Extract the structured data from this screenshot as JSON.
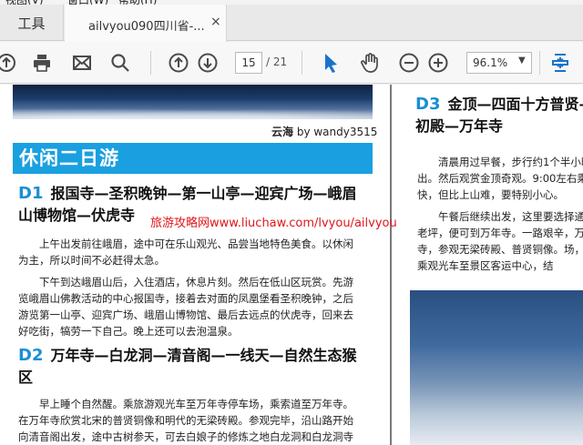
{
  "menu": {
    "items": [
      "视图(V)",
      "窗口(W)",
      "帮助(H)"
    ]
  },
  "tabs": {
    "tools_label": "工具",
    "doc_title": "ailvyou090四川省-...",
    "close_glyph": "×"
  },
  "toolbar": {
    "icons": [
      "upload-icon",
      "print-icon",
      "mail-icon",
      "search-icon",
      "prev-page-icon",
      "next-page-icon",
      "select-cursor-icon",
      "hand-icon",
      "zoom-out-icon",
      "zoom-in-icon",
      "fit-page-icon"
    ],
    "page_current": "15",
    "page_total": "/ 21",
    "zoom_value": "96.1%",
    "zoom_chevron": "▼",
    "accent": "#1a73c9"
  },
  "left_page": {
    "caption_bold": "云海",
    "caption_rest": " by wandy3515",
    "banner": "休闲二日游",
    "banner_color": "#1aa0e0",
    "d1": {
      "num": "D1",
      "title": "报国寺—圣积晚钟—第一山亭—迎宾广场—峨眉山博物馆—伏虎寺",
      "p1": "上午出发前往峨眉，途中可在乐山观光、品尝当地特色美食。以休闲为主，所以时间不必赶得太急。",
      "p2": "下午到达峨眉山后，入住酒店，休息片刻。然后在低山区玩赏。先游览峨眉山佛教活动的中心报国寺，接着去对面的凤凰堡看圣积晚钟，之后游览第一山亭、迎宾广场、峨眉山博物馆、最后去远点的伏虎寺，回来去好吃街，犒劳一下自己。晚上还可以去泡温泉。"
    },
    "d2": {
      "num": "D2",
      "title": "万年寺—白龙洞—清音阁—一线天—自然生态猴区",
      "p1": "早上睡个自然醒。乘旅游观光车至万年寺停车场，乘索道至万年寺。在万年寺欣赏北宋的普贤铜像和明代的无梁砖殿。参观完毕，沿山路开始向清音阁出发，途中古树参天，可去白娘子的修炼之地白龙洞和白龙洞寺"
    }
  },
  "watermark": "旅游攻略网www.liuchaw.com/lvyou/ailvyou",
  "right_page": {
    "d3": {
      "num": "D3",
      "title": "金顶—四面十方普贤—初殿—万年寺",
      "p1": "清晨用过早餐，步行约1个半小时出。然后观赏金顶奇观。9:00左右乘快，但比上山难，要特别小心。",
      "p2": "午餐后继续出发，这里要选择通长老坪，便可到万年寺。一路艰辛，万年寺，参观无梁砖殿、普贤铜像。场，再乘观光车至景区客运中心，结"
    }
  }
}
